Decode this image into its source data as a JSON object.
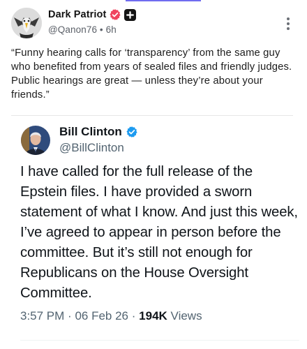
{
  "post": {
    "author_name": "Dark Patriot",
    "handle": "@Qanon76",
    "separator": "•",
    "age": "6h",
    "text": "“Funny hearing calls for ‘transparency’ from the same guy who benefited from years of sealed files and friendly judges. Public hearings are great — unless they’re about your friends.”",
    "icons": {
      "verified": "verified-badge-icon",
      "plus": "plus-badge-icon",
      "more": "more-vertical-icon",
      "avatar": "eagle-avatar"
    },
    "colors": {
      "verified_badge": "#f0445f",
      "plus_badge": "#141414"
    }
  },
  "quoted": {
    "author_name": "Bill Clinton",
    "handle": "@BillClinton",
    "text": "I have called for the full release of the Epstein files. I have provided a sworn statement of what I know. And just this week, I’ve agreed to appear in person before the committee. But it’s still not enough for Republicans on the House Oversight Committee.",
    "time": "3:57 PM",
    "date": "06 Feb 26",
    "dot": "·",
    "views_count": "194K",
    "views_label": "Views",
    "icons": {
      "verified": "verified-check-icon",
      "avatar": "portrait-avatar"
    },
    "colors": {
      "verified_badge": "#1d9bf0"
    }
  },
  "colors": {
    "top_accent": "#6f6cf0",
    "divider": "#e6e6e6"
  }
}
